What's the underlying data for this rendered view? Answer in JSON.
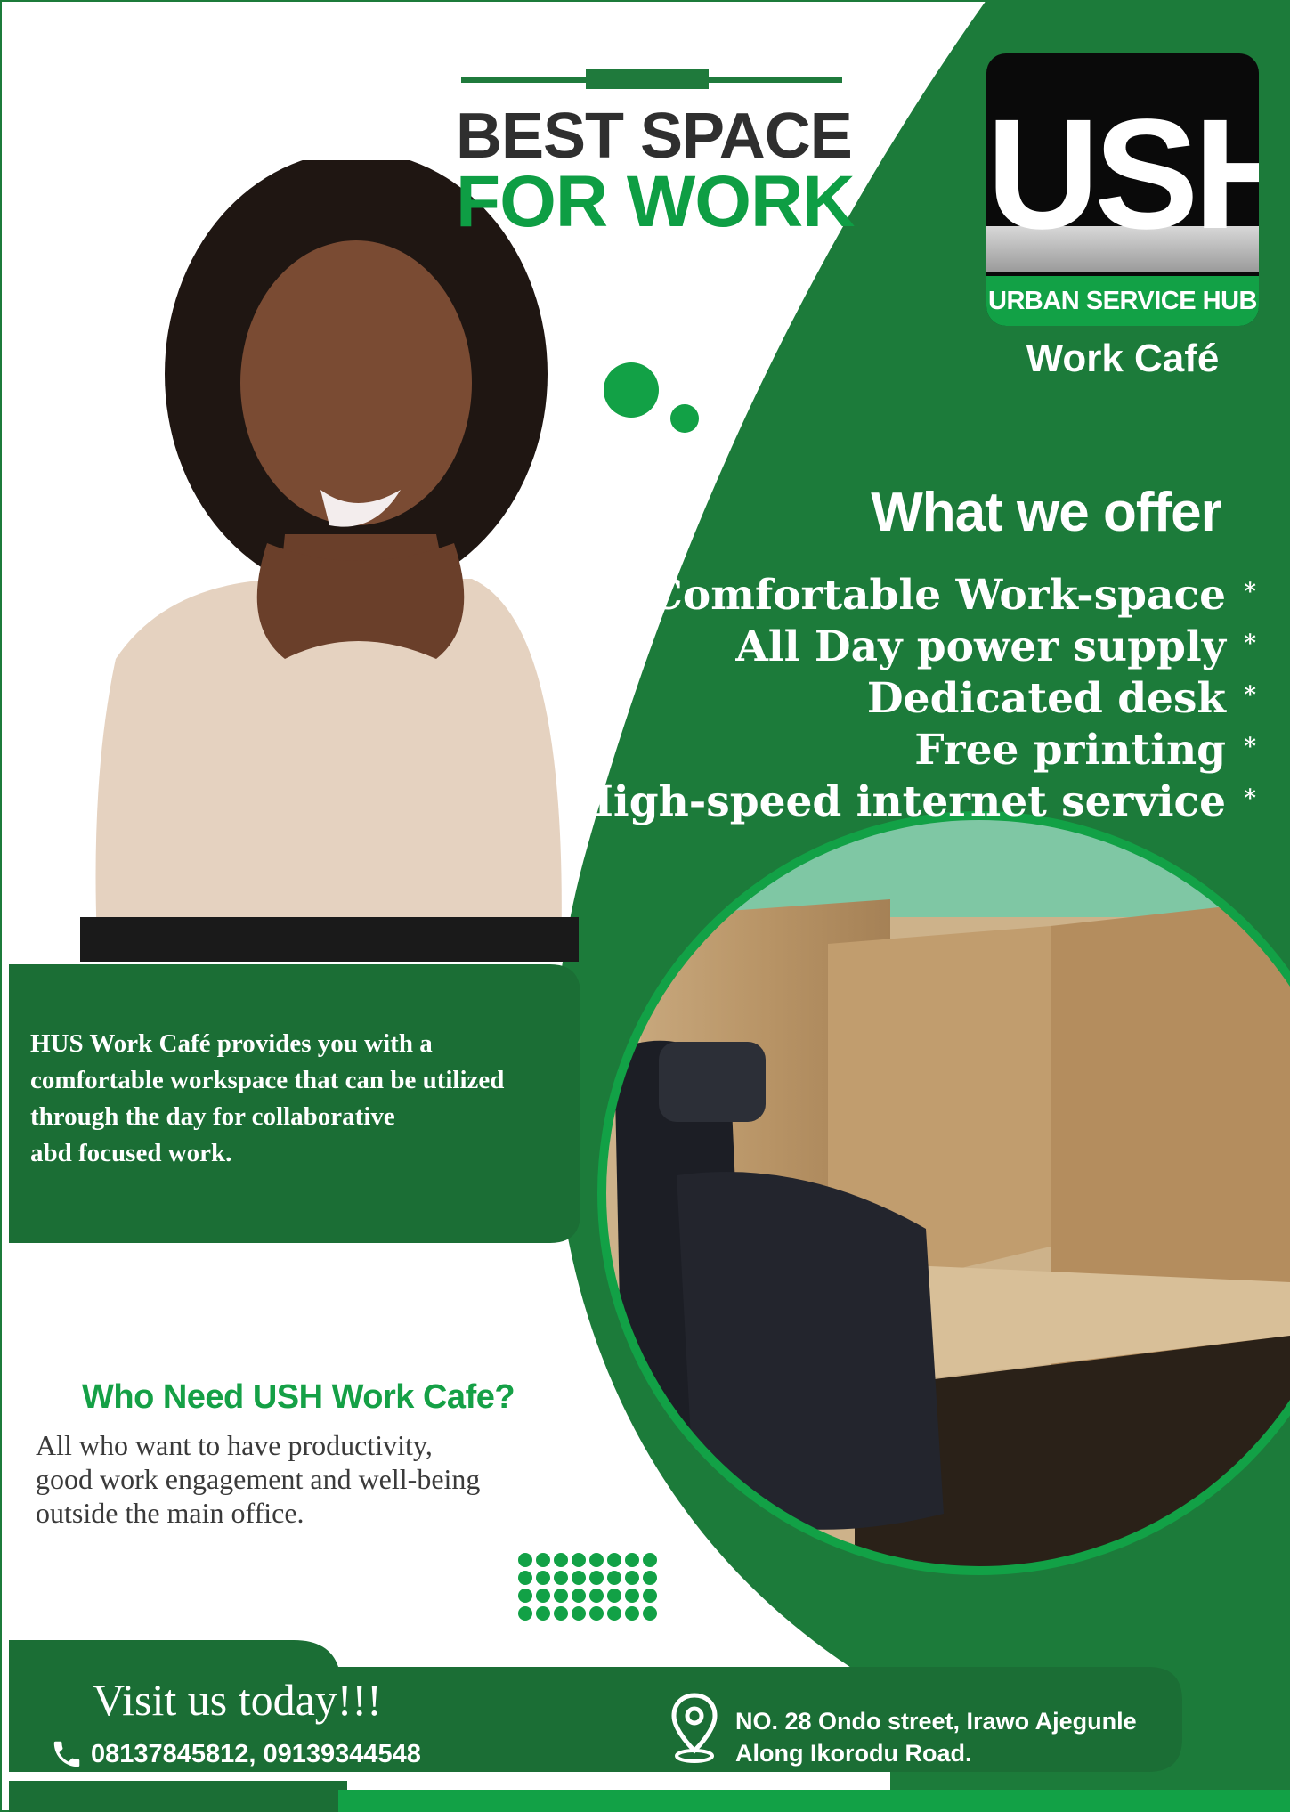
{
  "headline": {
    "line1": "BEST SPACE",
    "line2": "FOR WORK"
  },
  "logo": {
    "mark": "USH",
    "subtitle": "URBAN SERVICE HUB",
    "tagline": "Work Café"
  },
  "offer": {
    "title": "What we offer",
    "items": [
      "Comfortable Work-space",
      "All Day power supply",
      "Dedicated desk",
      "Free printing",
      "High-speed internet service"
    ],
    "bullet": "*"
  },
  "intro": {
    "lines": [
      "HUS Work Café provides you with a",
      "comfortable workspace that can be utilized",
      "through the day for collaborative",
      "abd focused work."
    ]
  },
  "who": {
    "title": "Who Need USH Work Cafe?",
    "lines": [
      "All who want to have productivity,",
      "good work engagement and well-being",
      "outside the main office."
    ]
  },
  "footer": {
    "visit": "Visit us today!!!",
    "phone": "08137845812, 09139344548",
    "address_line1": "NO. 28 Ondo street, Irawo Ajegunle",
    "address_line2": "Along Ikorodu Road."
  },
  "colors": {
    "brand_green": "#1c7b3a",
    "dark_green": "#0f5f29",
    "bright_green": "#12a146",
    "text_dark": "#2f2f2f"
  }
}
